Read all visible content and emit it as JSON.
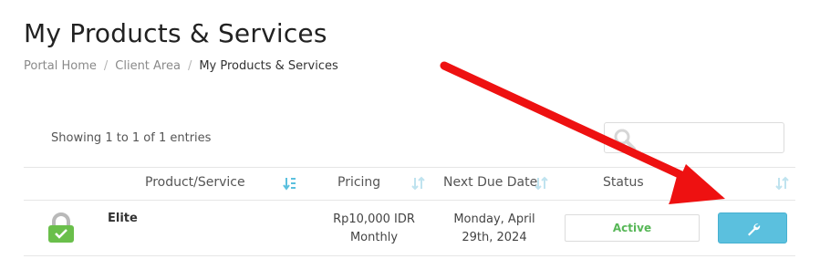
{
  "page": {
    "title": "My Products & Services"
  },
  "breadcrumb": [
    {
      "label": "Portal Home"
    },
    {
      "label": "Client Area"
    },
    {
      "label": "My Products & Services"
    }
  ],
  "table_info": {
    "showing_text": "Showing 1 to 1 of 1 entries"
  },
  "search": {
    "placeholder": "",
    "icon": "search-icon"
  },
  "table": {
    "columns": [
      "Product/Service",
      "Pricing",
      "Next Due Date",
      "Status",
      ""
    ],
    "rows": [
      {
        "icon": "lock-icon",
        "product": "Elite",
        "pricing_amount": "Rp10,000 IDR",
        "pricing_cycle": "Monthly",
        "due_line1": "Monday, April",
        "due_line2": "29th, 2024",
        "status": "Active",
        "action_icon": "wrench-icon"
      }
    ]
  },
  "colors": {
    "status_active": "#57b757",
    "action_button": "#5bc0de",
    "sort_icon": "#5bc0de",
    "arrow": "#ee1111",
    "lock_body": "#6abf4b"
  }
}
